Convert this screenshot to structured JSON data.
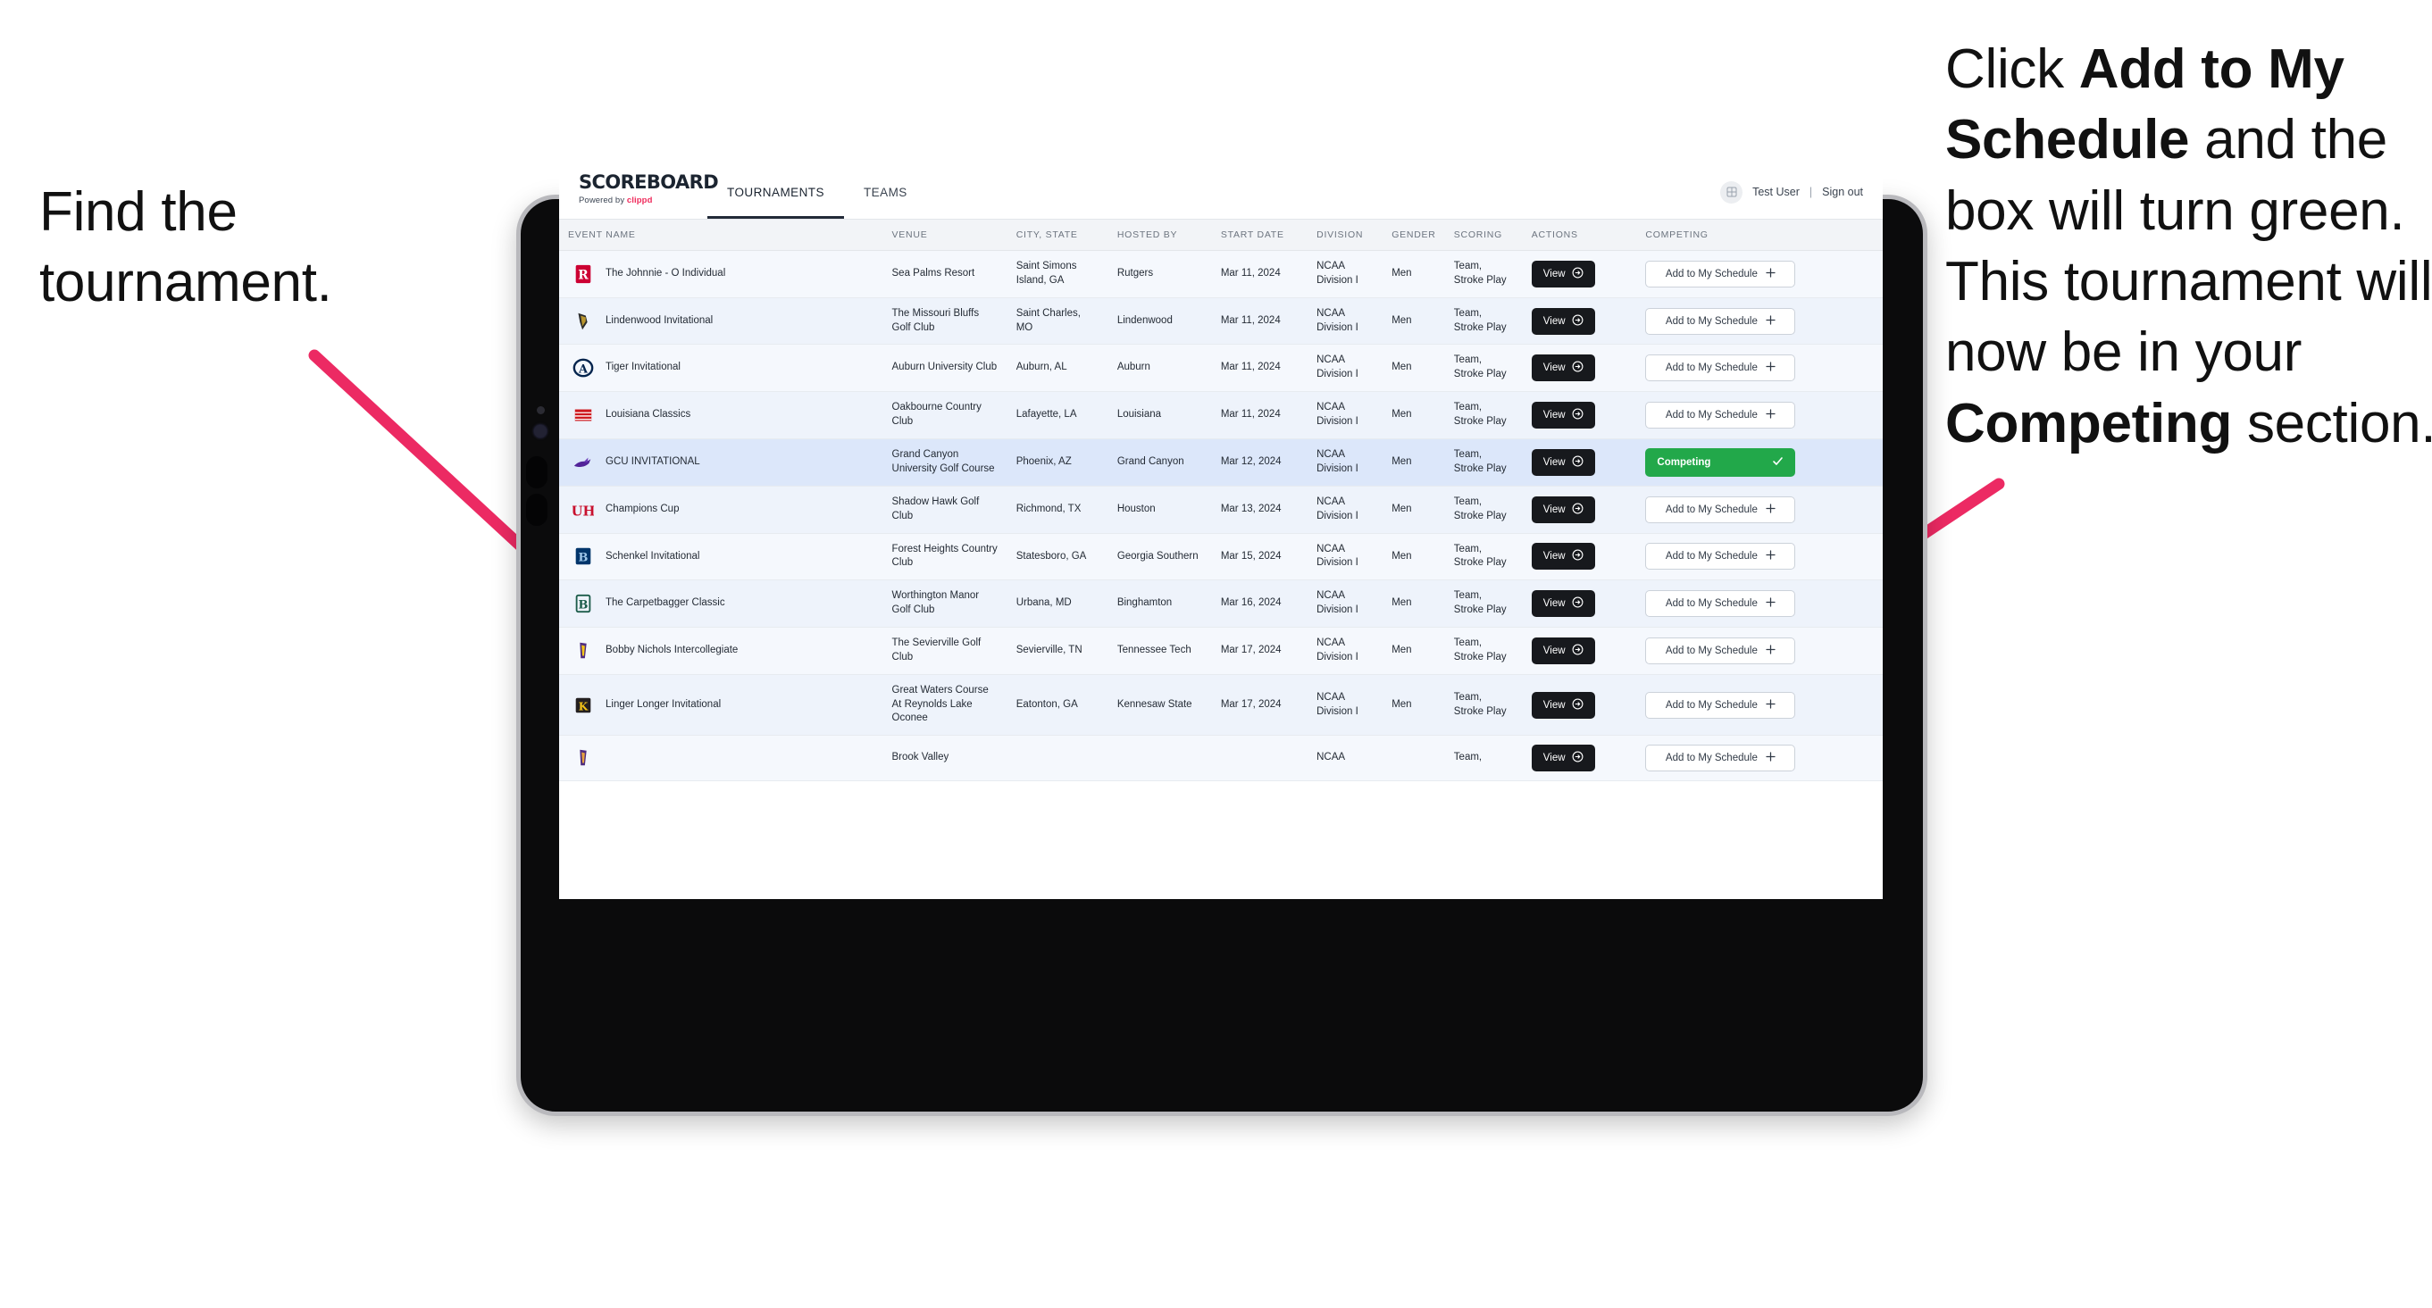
{
  "annotations": {
    "left": {
      "line1": "Find the",
      "line2": "tournament."
    },
    "right": {
      "seg1": "Click ",
      "bold1": "Add to My Schedule",
      "seg2": " and the box will turn green. This tournament will now be in your ",
      "bold2": "Competing",
      "seg3": " section."
    },
    "arrow_color": "#ec2a63"
  },
  "app": {
    "logo": {
      "word": "SCOREBOARD",
      "sub_pre": "Powered by ",
      "sub_brand": "clippd"
    },
    "nav": [
      {
        "label": "TOURNAMENTS",
        "active": true
      },
      {
        "label": "TEAMS",
        "active": false
      }
    ],
    "account": {
      "user": "Test User",
      "separator": "|",
      "sign_out": "Sign out",
      "avatar_icon": "grid-icon"
    }
  },
  "table": {
    "columns": [
      "EVENT NAME",
      "VENUE",
      "CITY, STATE",
      "HOSTED BY",
      "START DATE",
      "DIVISION",
      "GENDER",
      "SCORING",
      "ACTIONS",
      "COMPETING"
    ],
    "action_label": "View",
    "add_label": "Add to My Schedule",
    "add_icon": "plus-icon",
    "competing_label": "Competing",
    "competing_icon": "check-icon",
    "competing_color": "#22a84a",
    "rows": [
      {
        "event": "The Johnnie - O Individual",
        "logo": "rutgers-logo",
        "venue": "Sea Palms Resort",
        "city": "Saint Simons Island, GA",
        "host": "Rutgers",
        "date": "Mar 11, 2024",
        "division": "NCAA Division I",
        "gender": "Men",
        "scoring": "Team, Stroke Play",
        "competing": false
      },
      {
        "event": "Lindenwood Invitational",
        "logo": "lindenwood-logo",
        "venue": "The Missouri Bluffs Golf Club",
        "city": "Saint Charles, MO",
        "host": "Lindenwood",
        "date": "Mar 11, 2024",
        "division": "NCAA Division I",
        "gender": "Men",
        "scoring": "Team, Stroke Play",
        "competing": false
      },
      {
        "event": "Tiger Invitational",
        "logo": "auburn-logo",
        "venue": "Auburn University Club",
        "city": "Auburn, AL",
        "host": "Auburn",
        "date": "Mar 11, 2024",
        "division": "NCAA Division I",
        "gender": "Men",
        "scoring": "Team, Stroke Play",
        "competing": false
      },
      {
        "event": "Louisiana Classics",
        "logo": "louisiana-logo",
        "venue": "Oakbourne Country Club",
        "city": "Lafayette, LA",
        "host": "Louisiana",
        "date": "Mar 11, 2024",
        "division": "NCAA Division I",
        "gender": "Men",
        "scoring": "Team, Stroke Play",
        "competing": false
      },
      {
        "event": "GCU INVITATIONAL",
        "logo": "grand-canyon-logo",
        "venue": "Grand Canyon University Golf Course",
        "city": "Phoenix, AZ",
        "host": "Grand Canyon",
        "date": "Mar 12, 2024",
        "division": "NCAA Division I",
        "gender": "Men",
        "scoring": "Team, Stroke Play",
        "competing": true
      },
      {
        "event": "Champions Cup",
        "logo": "houston-logo",
        "venue": "Shadow Hawk Golf Club",
        "city": "Richmond, TX",
        "host": "Houston",
        "date": "Mar 13, 2024",
        "division": "NCAA Division I",
        "gender": "Men",
        "scoring": "Team, Stroke Play",
        "competing": false
      },
      {
        "event": "Schenkel Invitational",
        "logo": "georgia-southern-logo",
        "venue": "Forest Heights Country Club",
        "city": "Statesboro, GA",
        "host": "Georgia Southern",
        "date": "Mar 15, 2024",
        "division": "NCAA Division I",
        "gender": "Men",
        "scoring": "Team, Stroke Play",
        "competing": false
      },
      {
        "event": "The Carpetbagger Classic",
        "logo": "binghamton-logo",
        "venue": "Worthington Manor Golf Club",
        "city": "Urbana, MD",
        "host": "Binghamton",
        "date": "Mar 16, 2024",
        "division": "NCAA Division I",
        "gender": "Men",
        "scoring": "Team, Stroke Play",
        "competing": false
      },
      {
        "event": "Bobby Nichols Intercollegiate",
        "logo": "tennessee-tech-logo",
        "venue": "The Sevierville Golf Club",
        "city": "Sevierville, TN",
        "host": "Tennessee Tech",
        "date": "Mar 17, 2024",
        "division": "NCAA Division I",
        "gender": "Men",
        "scoring": "Team, Stroke Play",
        "competing": false
      },
      {
        "event": "Linger Longer Invitational",
        "logo": "kennesaw-state-logo",
        "venue": "Great Waters Course At Reynolds Lake Oconee",
        "city": "Eatonton, GA",
        "host": "Kennesaw State",
        "date": "Mar 17, 2024",
        "division": "NCAA Division I",
        "gender": "Men",
        "scoring": "Team, Stroke Play",
        "competing": false
      },
      {
        "event": "",
        "logo": "partial-logo",
        "venue": "Brook Valley",
        "city": "",
        "host": "",
        "date": "",
        "division": "NCAA",
        "gender": "",
        "scoring": "Team,",
        "competing": false
      }
    ]
  }
}
